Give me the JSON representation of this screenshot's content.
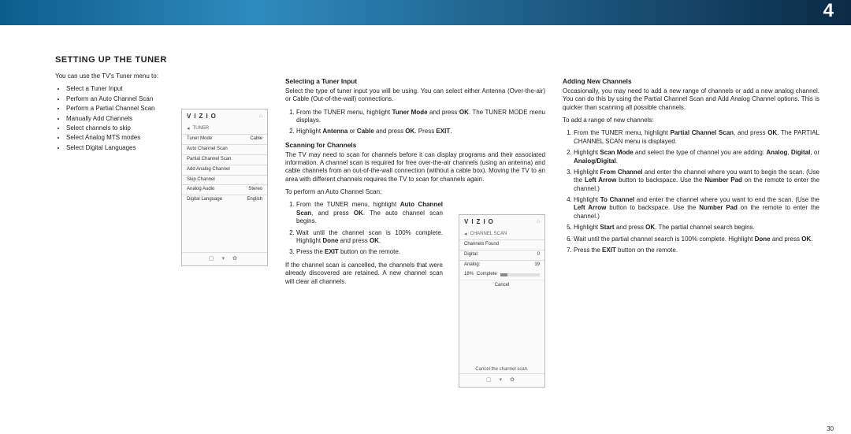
{
  "chapter_number": "4",
  "page_number": "30",
  "section_title": "SETTING UP THE TUNER",
  "intro": "You can use the TV's Tuner menu to:",
  "intro_bullets": [
    "Select a Tuner Input",
    "Perform an Auto Channel Scan",
    "Perform a Partial Channel Scan",
    "Manually Add Channels",
    "Select channels to skip",
    "Select Analog MTS modes",
    "Select Digital Languages"
  ],
  "tuner_panel": {
    "brand": "VIZIO",
    "title": "TUNER",
    "rows": [
      {
        "label": "Tuner Mode",
        "value": "Cable"
      },
      {
        "label": "Auto Channel Scan",
        "value": ""
      },
      {
        "label": "Partial Channel Scan",
        "value": ""
      },
      {
        "label": "Add Analog Channel",
        "value": ""
      },
      {
        "label": "Skip Channel",
        "value": ""
      },
      {
        "label": "Analog Audio",
        "value": "Stereo"
      },
      {
        "label": "Digital Language",
        "value": "English"
      }
    ]
  },
  "col2": {
    "select_input_head": "Selecting a Tuner Input",
    "select_input_text": "Select the type of tuner input you will be using. You can select either Antenna (Over-the-air) or Cable (Out-of-the-wall) connections.",
    "select_input_steps": [
      "From the TUNER menu, highlight <b>Tuner Mode</b> and press <b>OK</b>. The TUNER MODE menu displays.",
      "Highlight <b>Antenna</b> or <b>Cable</b> and press <b>OK</b>. Press <b>EXIT</b>."
    ],
    "scanning_head": "Scanning for Channels",
    "scanning_text": "The TV may need to scan for channels before it can display programs and their associated information. A channel scan is required for free over-the-air channels (using an antenna) and cable channels from an out-of-the-wall connection (without a cable box). Moving the TV to an area with different channels requires the TV to scan for channels again.",
    "perform_intro": "To perform an Auto Channel Scan:",
    "perform_steps": [
      "From the TUNER menu, highlight <b>Auto Channel Scan</b>, and press <b>OK</b>. The auto channel scan begins.",
      "Wait until the channel scan is 100% complete. Highlight <b>Done</b> and press <b>OK</b>.",
      "Press the <b>EXIT</b> button on the remote."
    ],
    "cancel_text": "If the channel scan is cancelled, the channels that were already discovered are retained. A new channel scan will clear all channels."
  },
  "scan_panel": {
    "brand": "VIZIO",
    "title": "CHANNEL SCAN",
    "found_label": "Channels Found",
    "digital_label": "Digital:",
    "digital_value": "0",
    "analog_label": "Analog:",
    "analog_value": "19",
    "percent": "18%",
    "complete_label": "Complete",
    "cancel_label": "Cancel",
    "caption": "Cancel the channel scan.",
    "progress_pct": 18
  },
  "col3": {
    "adding_head": "Adding New Channels",
    "adding_text": "Occasionally, you may need to add a new range of channels or add a new analog channel. You can do this by using the Partial Channel Scan and Add Analog Channel options. This is quicker than scanning all possible channels.",
    "adding_intro": "To add a range of new channels:",
    "adding_steps": [
      "From the TUNER menu, highlight <b>Partial Channel Scan</b>, and press <b>OK</b>. The PARTIAL CHANNEL SCAN menu is displayed.",
      "Highlight <b>Scan Mode</b> and select the type of channel you are adding: <b>Analog</b>, <b>Digital</b>, or <b>Analog/Digital</b>.",
      "Highlight <b>From Channel</b> and enter the channel where you want to begin the scan. (Use the <b>Left Arrow</b> button to backspace. Use the <b>Number Pad</b> on the remote to enter the channel.)",
      "Highlight <b>To Channel</b> and enter the channel where you want to end the scan. (Use the <b>Left Arrow</b> button to backspace. Use the <b>Number Pad</b> on the remote to enter the channel.)",
      "Highlight <b>Start</b> and press <b>OK</b>. The partial channel search begins.",
      "Wait until the partial channel search is 100% complete. Highlight <b>Done</b> and press <b>OK</b>.",
      "Press the <b>EXIT</b> button on the remote."
    ]
  }
}
